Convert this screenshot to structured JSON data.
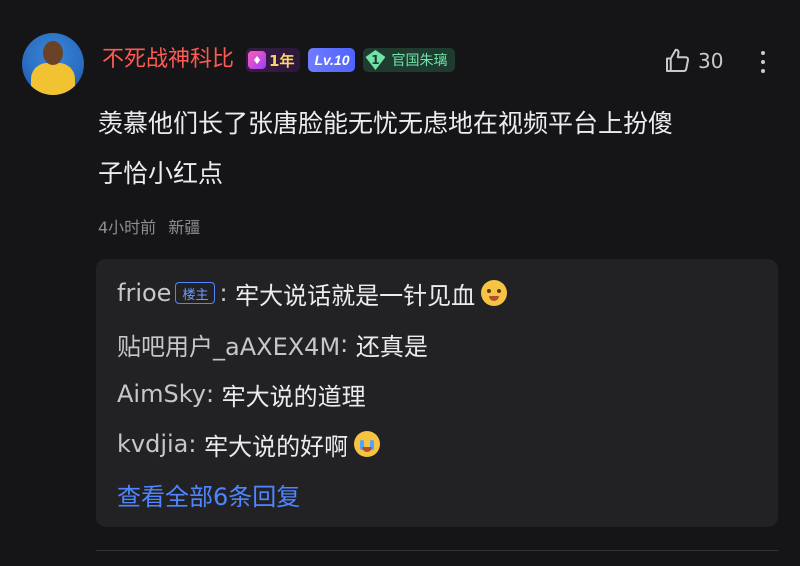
{
  "comment": {
    "username": "不死战神科比",
    "badges": {
      "year_label": "1年",
      "level_label": "Lv.10",
      "official_level": "1",
      "official_label": "官国朱璃"
    },
    "likes": "30",
    "content_line1": "羡慕他们长了张唐脸能无忧无虑地在视频平台上扮傻",
    "content_line2": "子恰小红点",
    "time": "4小时前",
    "location": "新疆"
  },
  "replies": {
    "items": [
      {
        "name": "frioe",
        "tag": "楼主",
        "text": "牢大说话就是一针见血",
        "emoji": "grin-sweat-emoji"
      },
      {
        "name": "贴吧用户_aAXEX4M",
        "text": "还真是"
      },
      {
        "name": "AimSky",
        "text": "牢大说的道理"
      },
      {
        "name": "kvdjia",
        "text": "牢大说的好啊",
        "emoji": "crying-emoji"
      }
    ],
    "view_all": "查看全部6条回复"
  },
  "colors": {
    "background": "#151518",
    "username": "#ff5a52",
    "link": "#4f86ff",
    "reply_panel": "#222225"
  }
}
